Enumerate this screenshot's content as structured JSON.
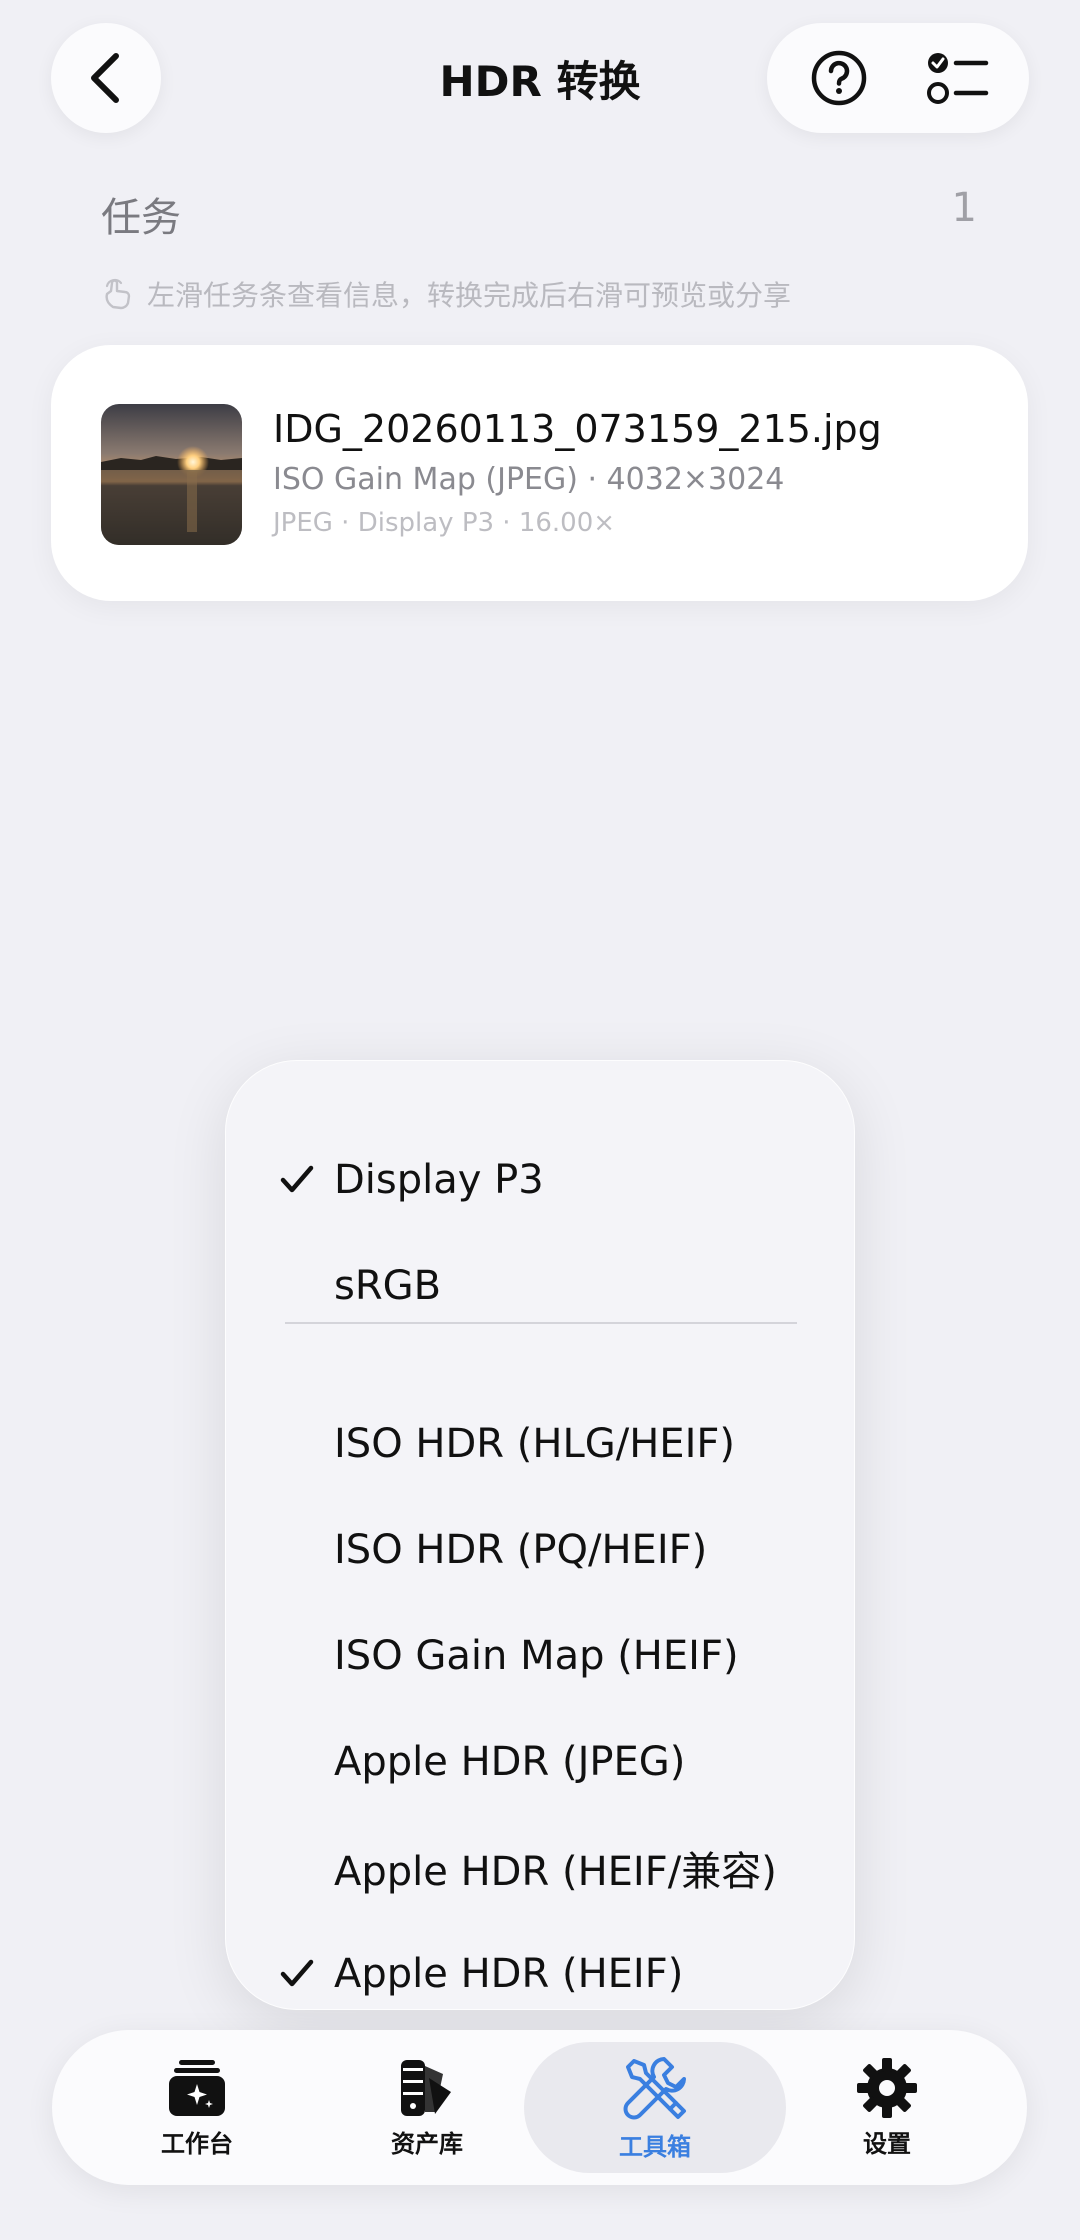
{
  "nav": {
    "title": "HDR 转换",
    "back_icon": "chevron-left-icon",
    "help_icon": "question-circle-icon",
    "select_icon": "checklist-icon"
  },
  "tasks": {
    "title": "任务",
    "count": "1",
    "hint": "左滑任务条查看信息，转换完成后右滑可预览或分享",
    "items": [
      {
        "filename": "IDG_20260113_073159_215.jpg",
        "meta": "ISO Gain Map (JPEG) · 4032×3024",
        "meta2": "JPEG · Display P3 · 16.00×"
      }
    ]
  },
  "menu": {
    "color_space": [
      {
        "label": "Display P3",
        "checked": true
      },
      {
        "label": "sRGB",
        "checked": false
      }
    ],
    "formats": [
      {
        "label": "ISO HDR (HLG/HEIF)",
        "checked": false
      },
      {
        "label": "ISO HDR (PQ/HEIF)",
        "checked": false
      },
      {
        "label": "ISO Gain Map (HEIF)",
        "checked": false
      },
      {
        "label": "Apple HDR (JPEG)",
        "checked": false
      },
      {
        "label": "Apple HDR (HEIF/兼容)",
        "checked": false
      },
      {
        "label": "Apple HDR (HEIF)",
        "checked": true
      }
    ]
  },
  "tabbar": {
    "items": [
      {
        "label": "工作台",
        "icon": "workbench-icon",
        "active": false
      },
      {
        "label": "资产库",
        "icon": "swatch-library-icon",
        "active": false
      },
      {
        "label": "工具箱",
        "icon": "tools-icon",
        "active": true
      },
      {
        "label": "设置",
        "icon": "gear-icon",
        "active": false
      }
    ]
  },
  "colors": {
    "accent": "#3a7fe0",
    "background": "#f0f0f5"
  }
}
